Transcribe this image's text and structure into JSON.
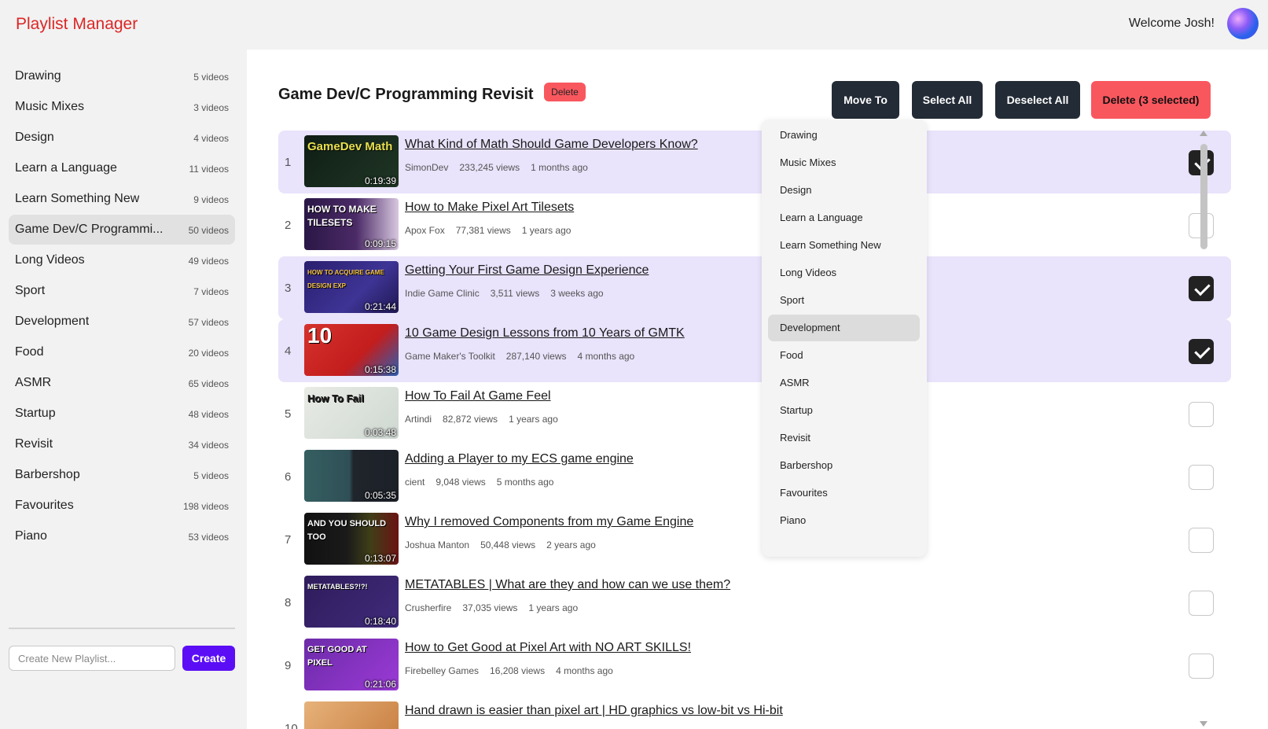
{
  "header": {
    "app_title": "Playlist Manager",
    "welcome": "Welcome Josh!"
  },
  "sidebar": {
    "playlists": [
      {
        "name": "Drawing",
        "count": "5 videos"
      },
      {
        "name": "Music Mixes",
        "count": "3 videos"
      },
      {
        "name": "Design",
        "count": "4 videos"
      },
      {
        "name": "Learn a Language",
        "count": "11 videos"
      },
      {
        "name": "Learn Something New",
        "count": "9 videos"
      },
      {
        "name": "Game Dev/C Programmi...",
        "count": "50 videos"
      },
      {
        "name": "Long Videos",
        "count": "49 videos"
      },
      {
        "name": "Sport",
        "count": "7 videos"
      },
      {
        "name": "Development",
        "count": "57 videos"
      },
      {
        "name": "Food",
        "count": "20 videos"
      },
      {
        "name": "ASMR",
        "count": "65 videos"
      },
      {
        "name": "Startup",
        "count": "48 videos"
      },
      {
        "name": "Revisit",
        "count": "34 videos"
      },
      {
        "name": "Barbershop",
        "count": "5 videos"
      },
      {
        "name": "Favourites",
        "count": "198 videos"
      },
      {
        "name": "Piano",
        "count": "53 videos"
      }
    ],
    "new_playlist_placeholder": "Create New Playlist...",
    "create_label": "Create"
  },
  "main": {
    "playlist_title": "Game Dev/C Programming Revisit",
    "delete_badge": "Delete",
    "toolbar": {
      "move_to": "Move To",
      "select_all": "Select All",
      "deselect_all": "Deselect All",
      "delete_selected": "Delete (3 selected)"
    },
    "videos": [
      {
        "num": "1",
        "title": "What Kind of Math Should Game Developers Know?",
        "channel": "SimonDev",
        "views": "233,245 views",
        "age": "1 months ago",
        "duration": "0:19:39",
        "thumb_text": "GameDev Math",
        "selected": true
      },
      {
        "num": "2",
        "title": "How to Make Pixel Art Tilesets",
        "channel": "Apox Fox",
        "views": "77,381 views",
        "age": "1 years ago",
        "duration": "0:09:15",
        "thumb_text": "HOW TO MAKE TILESETS",
        "selected": false
      },
      {
        "num": "3",
        "title": "Getting Your First Game Design Experience",
        "channel": "Indie Game Clinic",
        "views": "3,511 views",
        "age": "3 weeks ago",
        "duration": "0:21:44",
        "thumb_text": "HOW TO ACQUIRE GAME DESIGN EXP",
        "selected": true
      },
      {
        "num": "4",
        "title": "10 Game Design Lessons from 10 Years of GMTK",
        "channel": "Game Maker's Toolkit",
        "views": "287,140 views",
        "age": "4 months ago",
        "duration": "0:15:38",
        "thumb_text": "10",
        "selected": true
      },
      {
        "num": "5",
        "title": "How To Fail At Game Feel",
        "channel": "Artindi",
        "views": "82,872 views",
        "age": "1 years ago",
        "duration": "0:03:48",
        "thumb_text": "How To Fail",
        "selected": false
      },
      {
        "num": "6",
        "title": "Adding a Player to my ECS game engine",
        "channel": "cient",
        "views": "9,048 views",
        "age": "5 months ago",
        "duration": "0:05:35",
        "thumb_text": "",
        "selected": false
      },
      {
        "num": "7",
        "title": "Why I removed Components from my Game Engine",
        "channel": "Joshua Manton",
        "views": "50,448 views",
        "age": "2 years ago",
        "duration": "0:13:07",
        "thumb_text": "AND YOU SHOULD TOO",
        "selected": false
      },
      {
        "num": "8",
        "title": "METATABLES | What are they and how can we use them?",
        "channel": "Crusherfire",
        "views": "37,035 views",
        "age": "1 years ago",
        "duration": "0:18:40",
        "thumb_text": "METATABLES?!?!",
        "selected": false
      },
      {
        "num": "9",
        "title": "How to Get Good at Pixel Art with NO ART SKILLS!",
        "channel": "Firebelley Games",
        "views": "16,208 views",
        "age": "4 months ago",
        "duration": "0:21:06",
        "thumb_text": "GET GOOD AT PIXEL",
        "selected": false
      },
      {
        "num": "10",
        "title": "Hand drawn is easier than pixel art | HD graphics vs low-bit vs Hi-bit",
        "channel": "",
        "views": "",
        "age": "",
        "duration": "",
        "thumb_text": "",
        "selected": false
      }
    ]
  },
  "move_to_menu": {
    "items": [
      "Drawing",
      "Music Mixes",
      "Design",
      "Learn a Language",
      "Learn Something New",
      "Long Videos",
      "Sport",
      "Development",
      "Food",
      "ASMR",
      "Startup",
      "Revisit",
      "Barbershop",
      "Favourites",
      "Piano"
    ],
    "highlighted": "Development"
  },
  "colors": {
    "brand_red": "#dc2626",
    "dark_button": "#232b36",
    "danger": "#f9575e",
    "create": "#5b0ef5",
    "selected_row": "#e9e3fb"
  }
}
